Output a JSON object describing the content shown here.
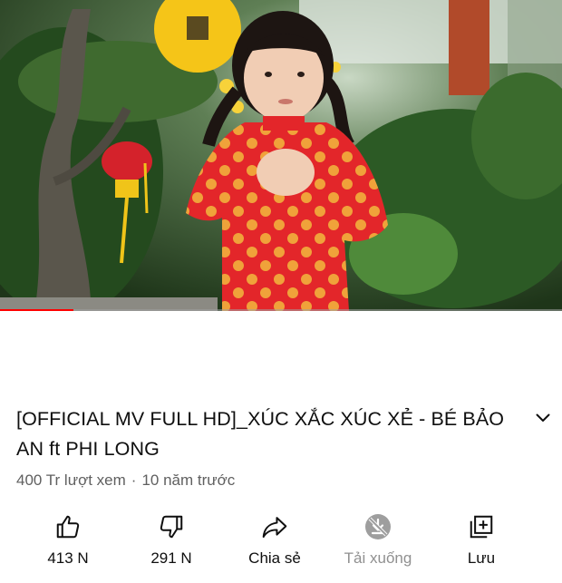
{
  "player": {
    "progress_fraction": 0.13,
    "progress_color": "#ff0000"
  },
  "video": {
    "title": "[OFFICIAL MV FULL HD]_XÚC XẮC XÚC XẺ - BÉ BẢO AN ft PHI LONG",
    "views": "400 Tr lượt xem",
    "separator": "·",
    "age": "10 năm trước"
  },
  "actions": {
    "like": {
      "label": "413 N",
      "icon": "thumbs-up-icon"
    },
    "dislike": {
      "label": "291 N",
      "icon": "thumbs-down-icon"
    },
    "share": {
      "label": "Chia sẻ",
      "icon": "share-arrow-icon"
    },
    "download": {
      "label": "Tải xuống",
      "icon": "download-disabled-icon",
      "disabled": true
    },
    "save": {
      "label": "Lưu",
      "icon": "playlist-add-icon"
    }
  },
  "colors": {
    "text_primary": "#0f0f0f",
    "text_secondary": "#606060",
    "text_disabled": "#909090"
  }
}
